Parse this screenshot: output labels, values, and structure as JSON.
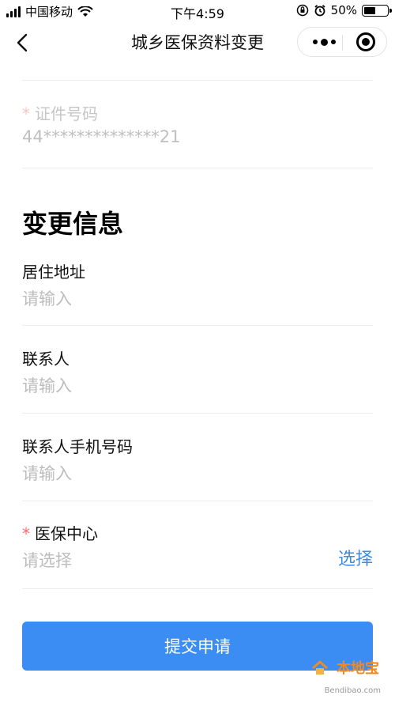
{
  "status_bar": {
    "carrier": "中国移动",
    "time": "下午4:59",
    "battery": "50%",
    "battery_level": 0.5
  },
  "nav": {
    "title": "城乡医保资料变更"
  },
  "id_field": {
    "required_mark": "*",
    "label": "证件号码",
    "value": "44**************21"
  },
  "change_section": {
    "title": "变更信息",
    "fields": [
      {
        "label": "居住地址",
        "placeholder": "请输入"
      },
      {
        "label": "联系人",
        "placeholder": "请输入"
      },
      {
        "label": "联系人手机号码",
        "placeholder": "请输入"
      }
    ],
    "medical_center": {
      "required_mark": "*",
      "label": "医保中心",
      "placeholder": "请选择",
      "action": "选择"
    }
  },
  "submit": {
    "label": "提交申请"
  },
  "watermark": {
    "text": "本地宝",
    "site": "Bendibao.com"
  },
  "colors": {
    "accent": "#3b8cf3",
    "link": "#3b8be8",
    "required": "#ff6a6a",
    "placeholder": "#bdbdbd"
  }
}
